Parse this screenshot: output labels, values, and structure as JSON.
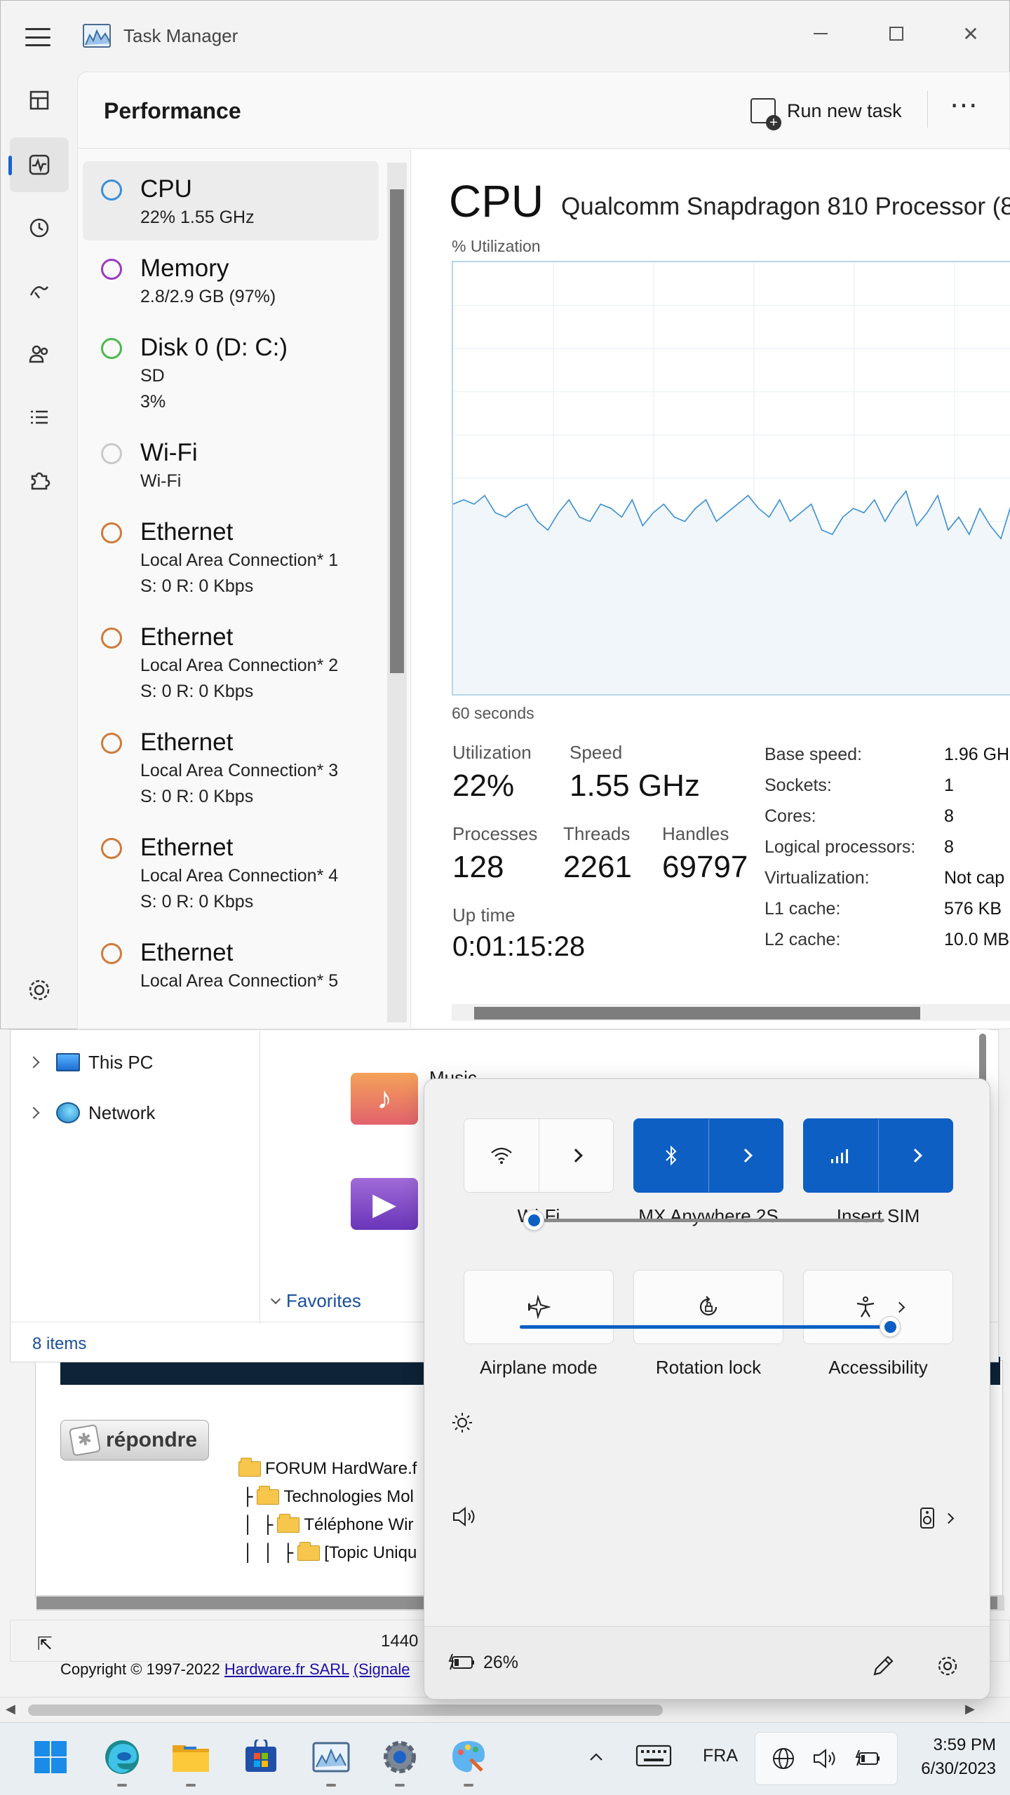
{
  "taskmgr": {
    "title": "Task Manager",
    "header": {
      "title": "Performance",
      "run_new_task": "Run new task",
      "more": "⋯"
    },
    "devices": [
      {
        "name": "CPU",
        "lines": [
          "22%  1.55 GHz"
        ],
        "color": "#3a8fd6",
        "selected": true
      },
      {
        "name": "Memory",
        "lines": [
          "2.8/2.9 GB (97%)"
        ],
        "color": "#9b3bbf"
      },
      {
        "name": "Disk 0 (D: C:)",
        "lines": [
          "SD",
          "3%"
        ],
        "color": "#4cb84c"
      },
      {
        "name": "Wi-Fi",
        "lines": [
          "Wi-Fi"
        ],
        "color": "#c9c9c9"
      },
      {
        "name": "Ethernet",
        "lines": [
          "Local Area Connection* 1",
          "S: 0 R: 0 Kbps"
        ],
        "color": "#d07a3a"
      },
      {
        "name": "Ethernet",
        "lines": [
          "Local Area Connection* 2",
          "S: 0 R: 0 Kbps"
        ],
        "color": "#d07a3a"
      },
      {
        "name": "Ethernet",
        "lines": [
          "Local Area Connection* 3",
          "S: 0 R: 0 Kbps"
        ],
        "color": "#d07a3a"
      },
      {
        "name": "Ethernet",
        "lines": [
          "Local Area Connection* 4",
          "S: 0 R: 0 Kbps"
        ],
        "color": "#d07a3a"
      },
      {
        "name": "Ethernet",
        "lines": [
          "Local Area Connection* 5"
        ],
        "color": "#d07a3a"
      }
    ],
    "cpu": {
      "heading": "CPU",
      "model": "Qualcomm Snapdragon 810 Processor (8",
      "util_label": "% Utilization",
      "graph_time": "60 seconds",
      "graph_percent_series": [
        44,
        45,
        44,
        46,
        42,
        41,
        43,
        44,
        40,
        38,
        42,
        45,
        41,
        40,
        44,
        43,
        41,
        45,
        39,
        42,
        44,
        41,
        40,
        43,
        45,
        40,
        42,
        44,
        46,
        43,
        41,
        45,
        40,
        42,
        44,
        38,
        37,
        41,
        43,
        42,
        45,
        40,
        44,
        47,
        39,
        42,
        46,
        38,
        41,
        37,
        43,
        39,
        36,
        44
      ],
      "stats": {
        "utilization_label": "Utilization",
        "utilization": "22%",
        "speed_label": "Speed",
        "speed": "1.55 GHz",
        "processes_label": "Processes",
        "processes": "128",
        "threads_label": "Threads",
        "threads": "2261",
        "handles_label": "Handles",
        "handles": "69797",
        "uptime_label": "Up time",
        "uptime": "0:01:15:28"
      },
      "specs": [
        {
          "k": "Base speed:",
          "v": "1.96 GH"
        },
        {
          "k": "Sockets:",
          "v": "1"
        },
        {
          "k": "Cores:",
          "v": "8"
        },
        {
          "k": "Logical processors:",
          "v": "8"
        },
        {
          "k": "Virtualization:",
          "v": "Not cap"
        },
        {
          "k": "L1 cache:",
          "v": "576 KB"
        },
        {
          "k": "L2 cache:",
          "v": "10.0 MB"
        }
      ]
    }
  },
  "explorer": {
    "nav": [
      {
        "label": "This PC"
      },
      {
        "label": "Network"
      }
    ],
    "music_label": "Music",
    "favorites": "Favorites",
    "items_count": "8 items"
  },
  "browser": {
    "reply_button": "répondre",
    "tree": [
      {
        "prefix": "",
        "label": "FORUM HardWare.f"
      },
      {
        "prefix": "├",
        "label": "Technologies Mol"
      },
      {
        "prefix": "│ ├",
        "label": "Téléphone Wir"
      },
      {
        "prefix": "│ │ ├",
        "label": "[Topic Uniqu"
      }
    ],
    "status_width_text": "1440",
    "copyright_prefix": "Copyright © 1997-2022 ",
    "copyright_link1": "Hardware.fr SARL",
    "copyright_link2": "(Signale"
  },
  "quick_settings": {
    "tiles": [
      {
        "label": "Wi-Fi",
        "state": "off",
        "icon": "wifi-icon"
      },
      {
        "label": "MX Anywhere 2S",
        "state": "on",
        "icon": "bluetooth-icon"
      },
      {
        "label": "Insert SIM",
        "state": "on",
        "icon": "cellular-icon"
      },
      {
        "label": "Airplane mode",
        "state": "off",
        "icon": "airplane-icon"
      },
      {
        "label": "Rotation lock",
        "state": "off",
        "icon": "rotation-lock-icon"
      },
      {
        "label": "Accessibility",
        "state": "off",
        "icon": "accessibility-icon"
      }
    ],
    "brightness_fraction": 0.0,
    "volume_fraction": 1.0,
    "battery": "26%",
    "accent": "#0e5fc4"
  },
  "taskbar": {
    "language": "FRA",
    "time": "3:59 PM",
    "date": "6/30/2023"
  }
}
